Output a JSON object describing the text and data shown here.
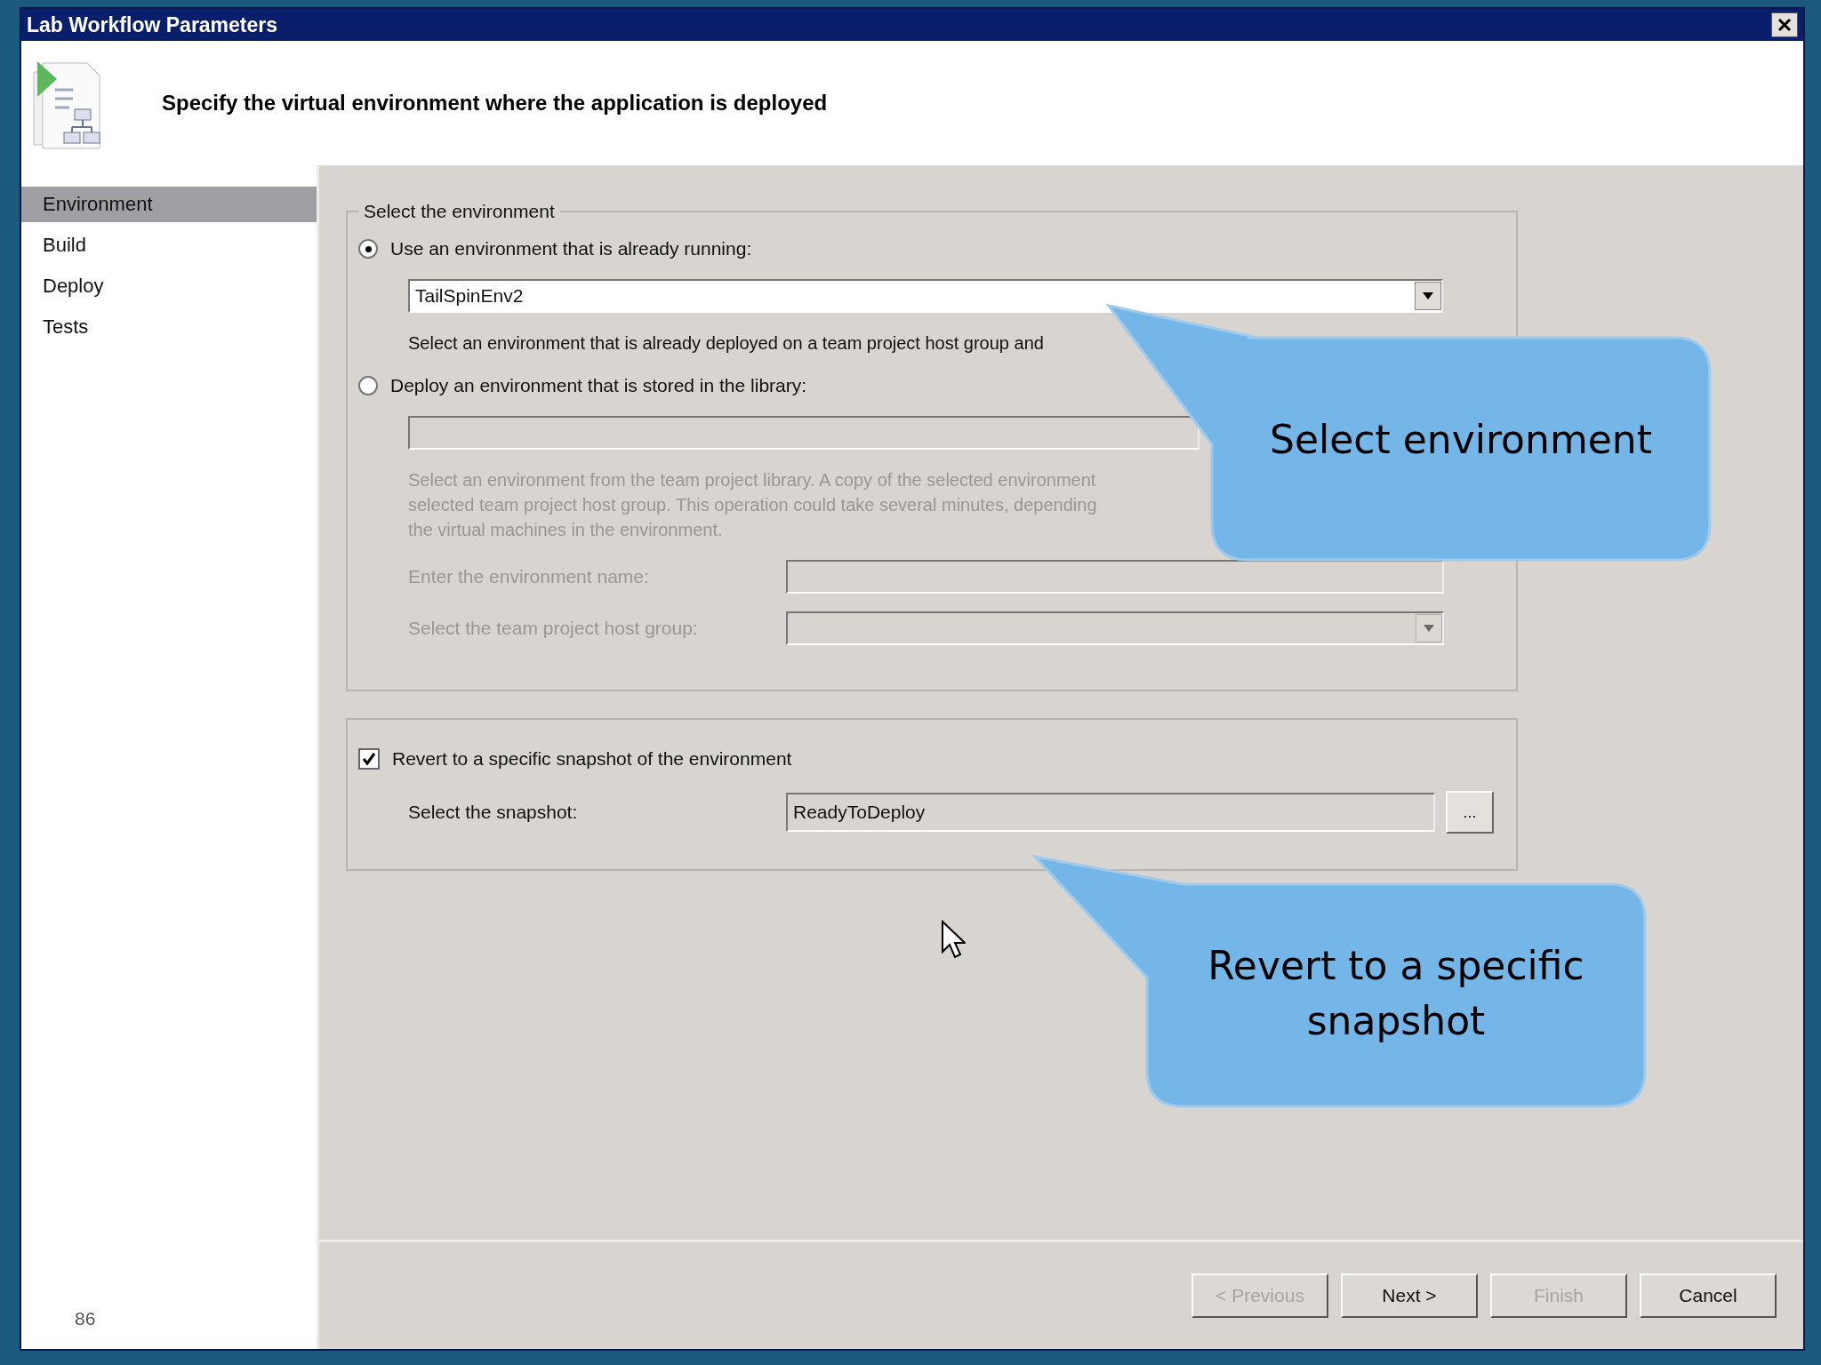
{
  "window": {
    "title": "Lab Workflow Parameters"
  },
  "header": {
    "text": "Specify the virtual environment where the application is deployed"
  },
  "sidebar": {
    "items": [
      {
        "label": "Environment",
        "selected": true
      },
      {
        "label": "Build",
        "selected": false
      },
      {
        "label": "Deploy",
        "selected": false
      },
      {
        "label": "Tests",
        "selected": false
      }
    ]
  },
  "environment_group": {
    "title": "Select the environment",
    "options": [
      {
        "label": "Use an environment that is already running:",
        "selected": true,
        "value": "TailSpinEnv2",
        "description": [
          "Select an environment that is already deployed on a team project host group and"
        ],
        "disabled": false
      },
      {
        "label": "Deploy an environment that is stored in the library:",
        "selected": false,
        "description": [
          "Select an environment from the team project library. A copy of the selected environment",
          "selected team project host group. This operation could take several minutes, depending",
          "the virtual machines in the environment."
        ],
        "disabled": true
      }
    ],
    "fields": [
      {
        "label": "Enter the environment name:",
        "kind": "text",
        "disabled": true
      },
      {
        "label": "Select the team project host group:",
        "kind": "combo",
        "disabled": true
      }
    ]
  },
  "snapshot_group": {
    "checkbox": {
      "label": "Revert to a specific snapshot of the environment",
      "checked": true
    },
    "label": "Select the snapshot:",
    "value": "ReadyToDeploy",
    "browse": "..."
  },
  "buttons": [
    {
      "label": "< Previous",
      "disabled": true
    },
    {
      "label": "Next >",
      "disabled": false
    },
    {
      "label": "Finish",
      "disabled": true
    },
    {
      "label": "Cancel",
      "disabled": false
    }
  ],
  "callouts": [
    "Select environment",
    "Revert to a specific snapshot"
  ],
  "page_number": "86"
}
